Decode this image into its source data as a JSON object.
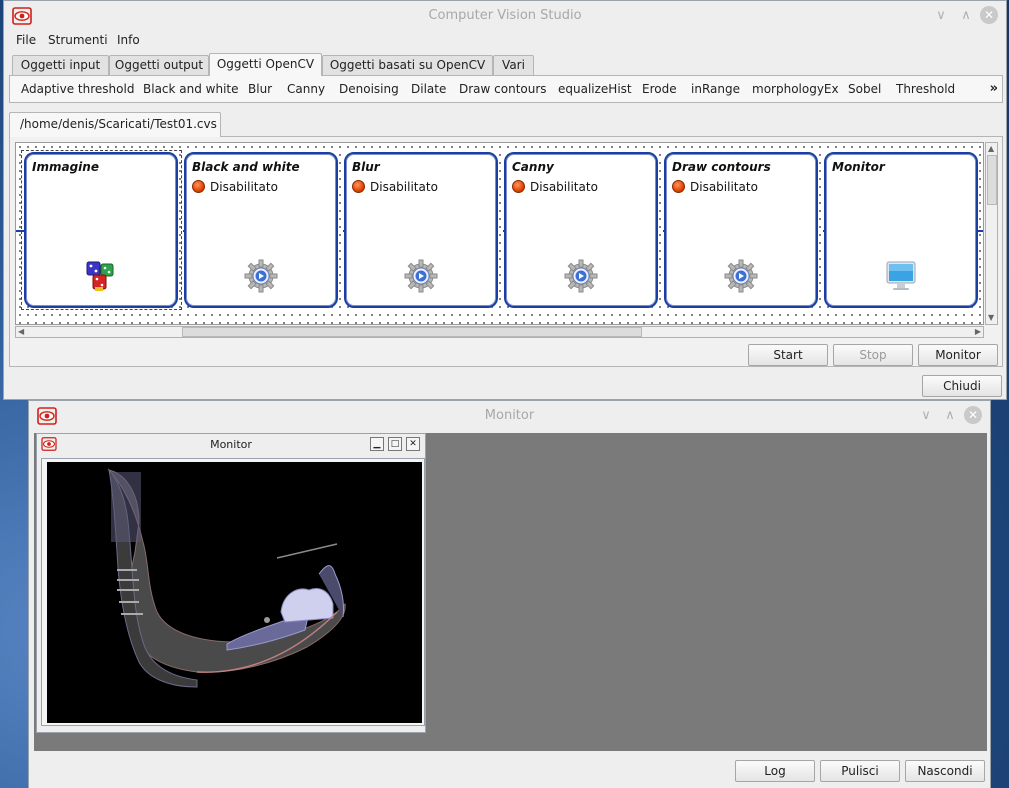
{
  "main_window": {
    "title": "Computer Vision Studio",
    "menu": [
      "File",
      "Strumenti",
      "Info"
    ],
    "tabs": [
      {
        "label": "Oggetti input",
        "active": false
      },
      {
        "label": "Oggetti output",
        "active": false
      },
      {
        "label": "Oggetti OpenCV",
        "active": true
      },
      {
        "label": "Oggetti basati su OpenCV",
        "active": false
      },
      {
        "label": "Vari",
        "active": false
      }
    ],
    "tools": [
      "Adaptive threshold",
      "Black and white",
      "Blur",
      "Canny",
      "Denoising",
      "Dilate",
      "Draw contours",
      "equalizeHist",
      "Erode",
      "inRange",
      "morphologyEx",
      "Sobel",
      "Threshold"
    ],
    "more_symbol": "»",
    "file_tab": "/home/denis/Scaricati/Test01.cvs",
    "nodes": [
      {
        "title": "Immagine",
        "status": "",
        "icon": "dice-icon"
      },
      {
        "title": "Black and white",
        "status": "Disabilitato",
        "icon": "gear-play-icon"
      },
      {
        "title": "Blur",
        "status": "Disabilitato",
        "icon": "gear-play-icon"
      },
      {
        "title": "Canny",
        "status": "Disabilitato",
        "icon": "gear-play-icon"
      },
      {
        "title": "Draw contours",
        "status": "Disabilitato",
        "icon": "gear-play-icon"
      },
      {
        "title": "Monitor",
        "status": "",
        "icon": "monitor-icon"
      }
    ],
    "buttons": {
      "start": "Start",
      "stop": "Stop",
      "monitor": "Monitor"
    },
    "close_button": "Chiudi",
    "window_controls": {
      "minimize": "∨",
      "maximize": "∧",
      "close": "✕"
    }
  },
  "monitor_window": {
    "title": "Monitor",
    "inner_title": "Monitor",
    "inner_controls": {
      "minimize": "▁",
      "maximize": "□",
      "close": "✕"
    },
    "buttons": {
      "log": "Log",
      "pulisci": "Pulisci",
      "nascondi": "Nascondi"
    },
    "window_controls": {
      "minimize": "∨",
      "maximize": "∧",
      "close": "✕"
    }
  },
  "colors": {
    "node_border": "#1b3fa0",
    "status_red": "#e2410b",
    "monitor_bg": "#7a7a7a"
  }
}
